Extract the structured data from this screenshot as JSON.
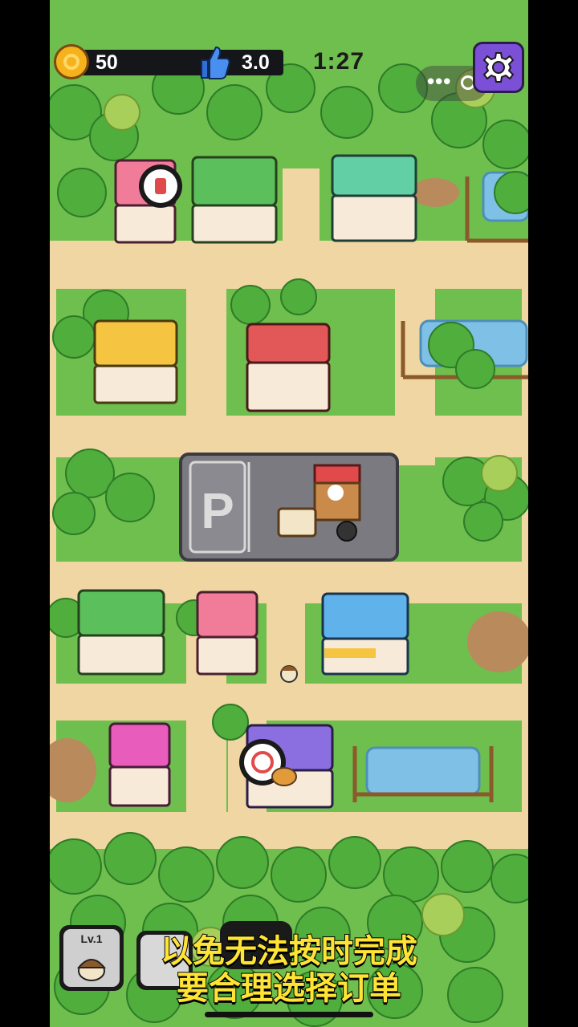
{
  "hud": {
    "coins": "50",
    "rating": "3.0",
    "timer": "1:27"
  },
  "level_card": {
    "label": "Lv.1"
  },
  "subtitle": {
    "line1": "以免无法按时完成",
    "line2": "要合理选择订单"
  },
  "parking": {
    "sign": "P"
  },
  "icons": {
    "coin": "coin-icon",
    "rating": "thumbs-up-icon",
    "settings": "gear-icon",
    "more": "more-dots-icon",
    "close": "target-ring-icon"
  },
  "colors": {
    "grass": "#6fbf4e",
    "path": "#f0d6a2",
    "tree": "#4fae3c",
    "water": "#7fc0e6",
    "asphalt": "#7a7a80",
    "subtitle": "#ffe436",
    "settings_bg": "#7b4fd6"
  }
}
